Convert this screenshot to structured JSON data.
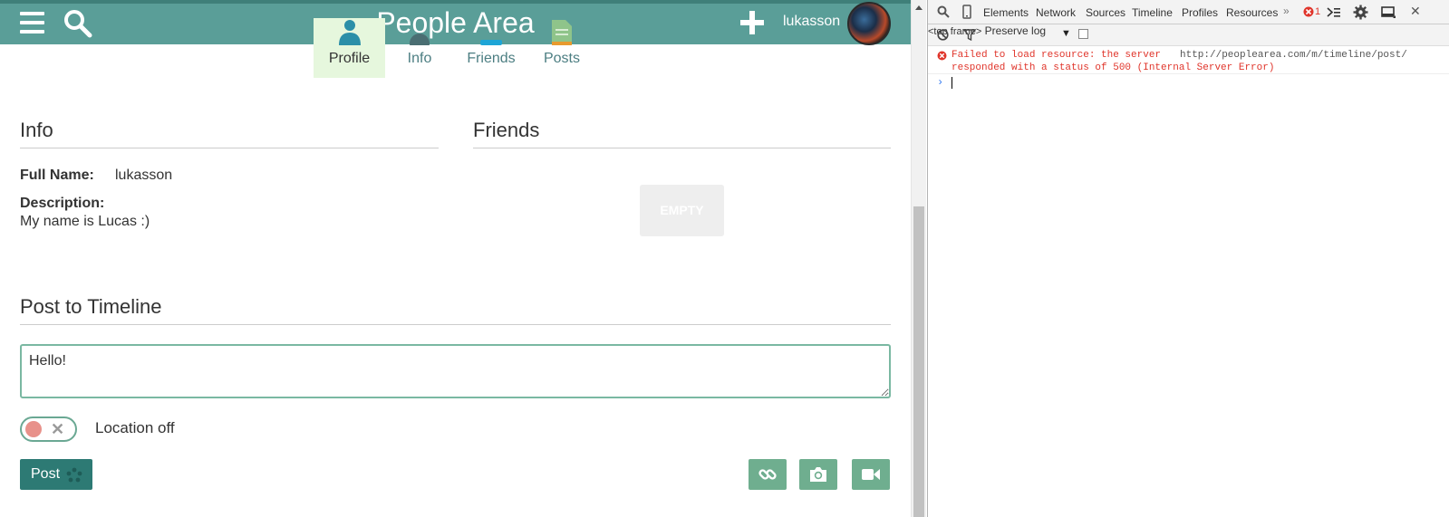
{
  "app": {
    "title": "People Area",
    "username": "lukasson",
    "tabs": [
      {
        "label": "Profile",
        "icon": "person-icon",
        "active": true
      },
      {
        "label": "Info",
        "icon": "info-icon",
        "active": false
      },
      {
        "label": "Friends",
        "icon": "friends-icon",
        "active": false
      },
      {
        "label": "Posts",
        "icon": "document-icon",
        "active": false
      }
    ],
    "info": {
      "heading": "Info",
      "full_name_label": "Full Name:",
      "full_name_value": "lukasson",
      "description_label": "Description:",
      "description_value": "My name is Lucas :)"
    },
    "friends": {
      "heading": "Friends",
      "empty_label": "EMPTY"
    },
    "post": {
      "heading": "Post to Timeline",
      "textarea_value": "Hello!",
      "location_label": "Location off",
      "location_enabled": false,
      "post_button": "Post"
    },
    "colors": {
      "header": "#5a9e98",
      "post_button": "#2d7a74",
      "attach_button": "#6fae8f",
      "active_tab": "#e6f7dd"
    }
  },
  "devtools": {
    "tabs": [
      "Elements",
      "Network",
      "Sources",
      "Timeline",
      "Profiles",
      "Resources"
    ],
    "more": "»",
    "error_count": "1",
    "frame_selector": "<top frame>",
    "preserve_log_label": "Preserve log",
    "preserve_log_checked": false,
    "console": {
      "error_message": "Failed to load resource: the server\nresponded with a status of 500 (Internal Server Error)",
      "error_url": "http://peoplearea.com/m/timeline/post/",
      "prompt": "›"
    }
  }
}
